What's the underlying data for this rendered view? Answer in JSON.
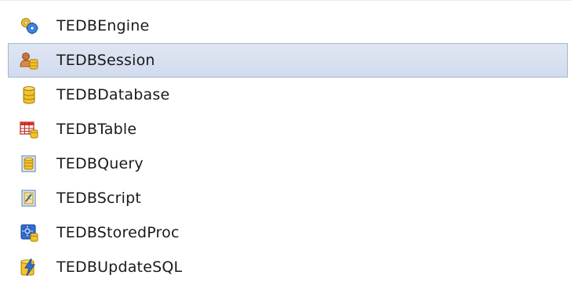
{
  "components": [
    {
      "label": "TEDBEngine",
      "icon": "engine-gears-icon",
      "selected": false
    },
    {
      "label": "TEDBSession",
      "icon": "session-users-icon",
      "selected": true
    },
    {
      "label": "TEDBDatabase",
      "icon": "database-cylinder-icon",
      "selected": false
    },
    {
      "label": "TEDBTable",
      "icon": "table-grid-icon",
      "selected": false
    },
    {
      "label": "TEDBQuery",
      "icon": "query-document-icon",
      "selected": false
    },
    {
      "label": "TEDBScript",
      "icon": "script-document-icon",
      "selected": false
    },
    {
      "label": "TEDBStoredProc",
      "icon": "stored-procedure-gear-icon",
      "selected": false
    },
    {
      "label": "TEDBUpdateSQL",
      "icon": "update-sql-lightning-icon",
      "selected": false
    }
  ],
  "colors": {
    "selection_background": "#d8e0f1",
    "selection_border": "#a9b5cf",
    "icon_yellow": "#f2c230",
    "icon_blue": "#2d6fd6",
    "icon_red": "#d9332b"
  }
}
